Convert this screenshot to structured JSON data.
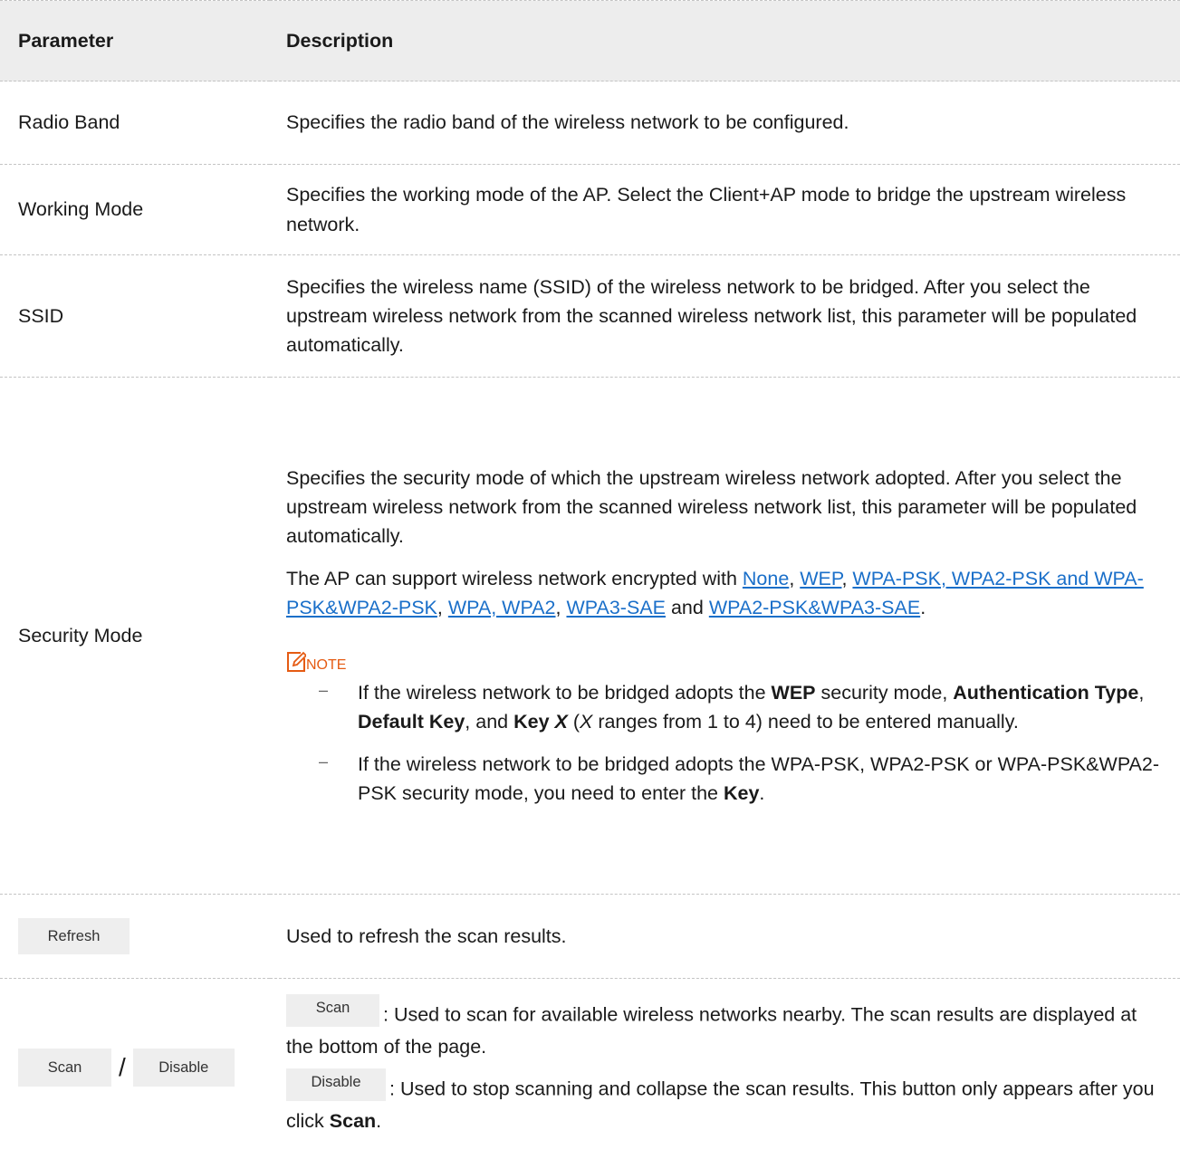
{
  "header": {
    "parameter": "Parameter",
    "description": "Description"
  },
  "rows": {
    "radio_band": {
      "param": "Radio Band",
      "desc": "Specifies the radio band of the wireless network to be configured."
    },
    "working_mode": {
      "param": "Working Mode",
      "desc": "Specifies the working mode of the AP. Select the Client+AP mode to bridge the upstream wireless network."
    },
    "ssid": {
      "param": "SSID",
      "desc": "Specifies the wireless name (SSID) of the wireless network to be bridged. After you select the upstream wireless network from the scanned wireless network list, this parameter will be populated automatically."
    },
    "security_mode": {
      "param": "Security Mode",
      "desc1": "Specifies the security mode of which the upstream wireless network adopted. After you select the upstream wireless network from the scanned wireless network list, this parameter will be populated automatically.",
      "desc2_prefix": "The AP can support wireless network encrypted with ",
      "links": [
        "None",
        "WEP",
        "WPA-PSK, WPA2-PSK and WPA-PSK&WPA2-PSK",
        "WPA, WPA2",
        "WPA3-SAE",
        "WPA2-PSK&WPA3-SAE"
      ],
      "sep_comma": ", ",
      "sep_and": " and ",
      "period": ".",
      "note_label": "NOTE",
      "note1": {
        "t1": "If the wireless network to be bridged adopts the ",
        "b1": "WEP",
        "t2": " security mode, ",
        "b2": "Authentication Type",
        "t3": ", ",
        "b3": "Default Key",
        "t4": ", and ",
        "b4": "Key ",
        "bi": "X",
        "t5": " (",
        "i1": "X",
        "t6": " ranges from 1 to 4) need to be entered manually."
      },
      "note2": {
        "t1": "If the wireless network to be bridged adopts the WPA-PSK, WPA2-PSK or WPA-PSK&WPA2-PSK security mode, you need to enter the ",
        "b1": "Key",
        "t2": "."
      },
      "dash": "–"
    },
    "refresh": {
      "button": "Refresh",
      "desc": "Used to refresh the scan results."
    },
    "scan_disable": {
      "scan_button": "Scan",
      "slash": "/",
      "disable_button": "Disable",
      "scan_desc": ": Used to scan for available wireless networks nearby. The scan results are displayed at the bottom of the page.",
      "disable_desc": ": Used to stop scanning and collapse the scan results. This button only appears after you click ",
      "disable_bold": "Scan",
      "period": "."
    }
  },
  "colors": {
    "header_bg": "#ededed",
    "link": "#1a6fc9",
    "note": "#e55b13",
    "button_bg": "#eeeeee"
  }
}
